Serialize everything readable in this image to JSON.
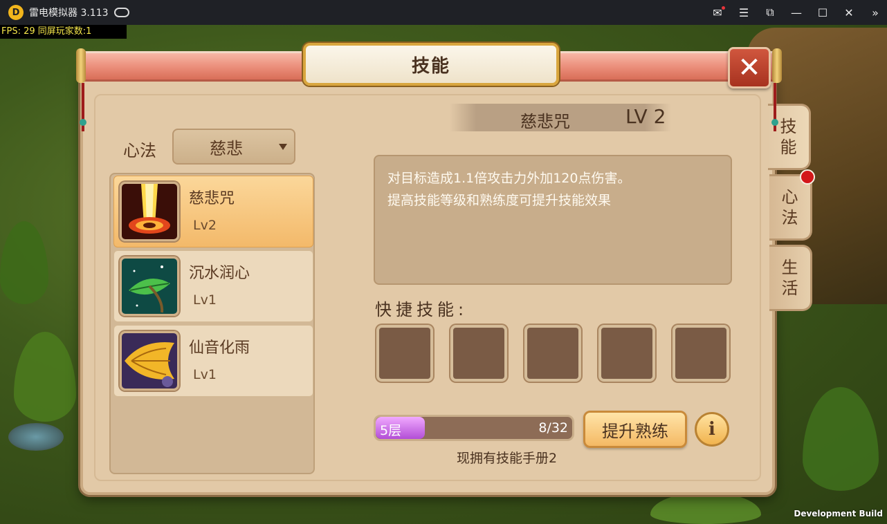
{
  "emulator": {
    "title": "雷电模拟器 3.113",
    "fps": "FPS: 29 同屏玩家数:1",
    "dev_build": "Development Build"
  },
  "window": {
    "title": "技能",
    "close_icon": "close-icon"
  },
  "side_tabs": [
    {
      "label": "技\n能",
      "active": true
    },
    {
      "label": "心\n法",
      "active": false,
      "notification": true
    },
    {
      "label": "生\n活",
      "active": false
    }
  ],
  "xinfa": {
    "label": "心法",
    "selected": "慈悲"
  },
  "skills": [
    {
      "name": "慈悲咒",
      "level": "Lv2",
      "selected": true,
      "icon": "golden-burst-icon"
    },
    {
      "name": "沉水润心",
      "level": "Lv1",
      "selected": false,
      "icon": "leaf-water-icon"
    },
    {
      "name": "仙音化雨",
      "level": "Lv1",
      "selected": false,
      "icon": "golden-feather-icon"
    }
  ],
  "detail": {
    "name": "慈悲咒",
    "level": "LV 2",
    "description": [
      "对目标造成1.1倍攻击力外加120点伤害。",
      "提高技能等级和熟练度可提升技能效果"
    ],
    "quick_label": "快捷技能:",
    "quick_slot_count": 5
  },
  "proficiency": {
    "layer": "5层",
    "count": "8/32",
    "fraction": 0.25,
    "upgrade_label": "提升熟练",
    "info_label": "i",
    "handbook": "现拥有技能手册2"
  },
  "colors": {
    "panel": "#e2c9a7",
    "title_bar": "#ea8c78",
    "selected_item": "#f3b96a",
    "progress": "#b24ed6",
    "notification": "#d3171a"
  }
}
